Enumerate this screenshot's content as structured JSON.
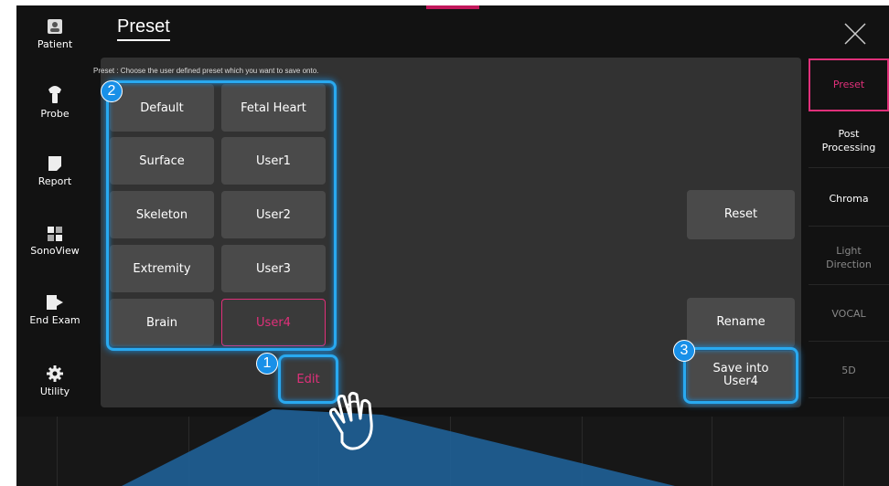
{
  "title": "Preset",
  "hint": "Preset : Choose the user defined preset which you want to save onto.",
  "sidebar": [
    {
      "label": "Patient",
      "icon": "patient-icon"
    },
    {
      "label": "Probe",
      "icon": "probe-icon"
    },
    {
      "label": "Report",
      "icon": "report-icon"
    },
    {
      "label": "SonoView",
      "icon": "sonoview-icon"
    },
    {
      "label": "End Exam",
      "icon": "end-exam-icon"
    },
    {
      "label": "Utility",
      "icon": "gear-icon"
    }
  ],
  "presets": [
    [
      "Default",
      "Fetal Heart"
    ],
    [
      "Surface",
      "User1"
    ],
    [
      "Skeleton",
      "User2"
    ],
    [
      "Extremity",
      "User3"
    ],
    [
      "Brain",
      "User4"
    ]
  ],
  "selected_preset": "User4",
  "edit_label": "Edit",
  "reset_label": "Reset",
  "rename_label": "Rename",
  "save_label": "Save into\nUser4",
  "tabs": [
    {
      "label": "Preset",
      "state": "active"
    },
    {
      "label": "Post\nProcessing",
      "state": "normal"
    },
    {
      "label": "Chroma",
      "state": "normal"
    },
    {
      "label": "Light\nDirection",
      "state": "dim"
    },
    {
      "label": "VOCAL",
      "state": "dim"
    },
    {
      "label": "5D",
      "state": "dim"
    }
  ],
  "markers": [
    "1",
    "2",
    "3"
  ],
  "colors": {
    "accent": "#e0307a",
    "highlight": "#29a9f0",
    "panel": "#323232"
  }
}
